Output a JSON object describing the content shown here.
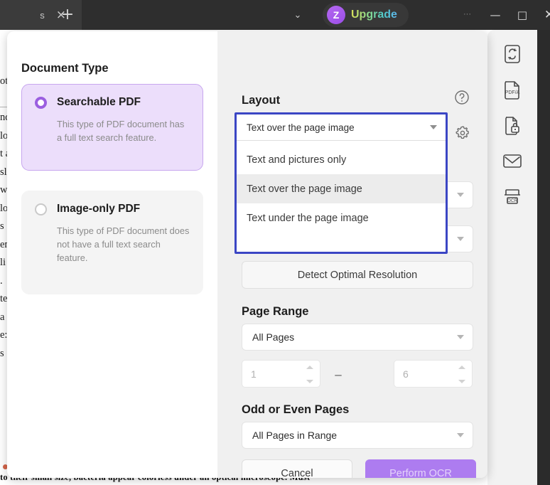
{
  "titlebar": {
    "tab_label": "s",
    "close_icon": "×",
    "newtab_icon": "+",
    "chevron_icon": "⌄",
    "overflow_dots": "···",
    "upgrade_badge": "Z",
    "upgrade_label": "Upgrade",
    "minimize_icon": "—",
    "maximize_icon": "□",
    "close_window_icon": "✕"
  },
  "document_background": {
    "column_text": "ot\n\nnd\nlo\nt a\nsl\nw\nlo\ns\nen\nli\n.\nte\na\ne:\ns",
    "highlight_text": "a",
    "bottom_line": "to their small size, bacteria appear colorless under an optical microscope. Must"
  },
  "rail": {
    "items": [
      {
        "icon": "convert-pdf-icon",
        "label": "Convert"
      },
      {
        "icon": "pdfa-icon",
        "label": "PDF/A"
      },
      {
        "icon": "protect-icon",
        "label": "Protect"
      },
      {
        "icon": "email-icon",
        "label": "Email"
      },
      {
        "icon": "ocr-icon",
        "label": "OCR"
      }
    ]
  },
  "dialog": {
    "document_type": {
      "title": "Document Type",
      "options": [
        {
          "label": "Searchable PDF",
          "description": "This type of PDF document has a full text search feature.",
          "selected": true
        },
        {
          "label": "Image-only PDF",
          "description": "This type of PDF document does not have a full text search feature.",
          "selected": false
        }
      ]
    },
    "layout": {
      "title": "Layout",
      "help_icon": "?",
      "gear_icon": "gear-icon",
      "selected_value": "Text over the page image",
      "options": [
        "Text and pictures only",
        "Text over the page image",
        "Text under the page image"
      ],
      "active_option_index": 1,
      "dropdown_open": true,
      "border_color": "#3b46c4"
    },
    "detect_button": "Detect Optimal Resolution",
    "page_range": {
      "title": "Page Range",
      "selected_value": "All Pages",
      "from_value": "1",
      "to_value": "6",
      "separator": "–"
    },
    "odd_or_even": {
      "title": "Odd or Even Pages",
      "selected_value": "All Pages in Range"
    },
    "actions": {
      "cancel_label": "Cancel",
      "confirm_label": "Perform OCR",
      "confirm_color": "#ad7cf0"
    }
  }
}
